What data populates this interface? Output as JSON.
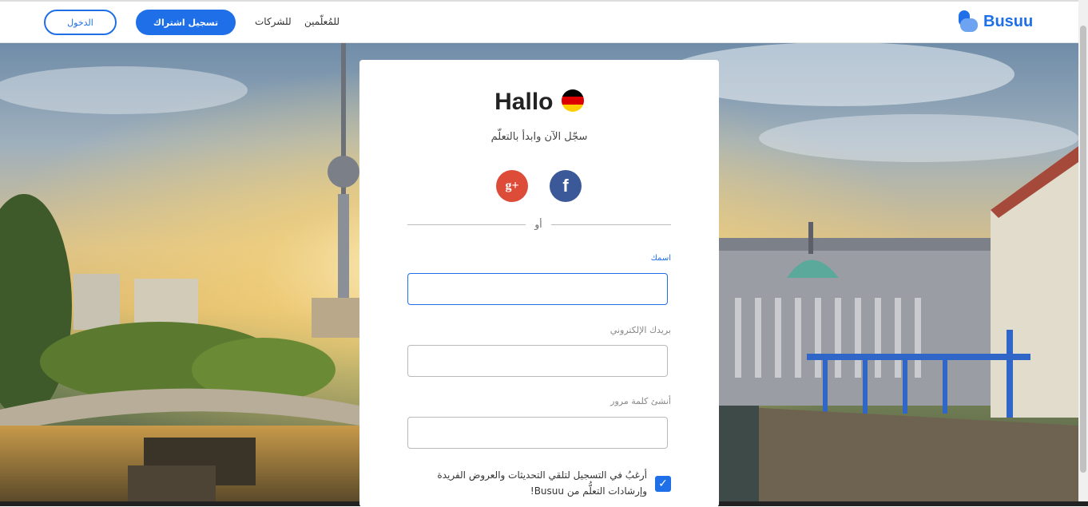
{
  "header": {
    "logo_text": "Busuu",
    "login_label": "الدخول",
    "signup_label": "تسجيل اشتراك",
    "companies_label": "للشركات",
    "teachers_label": "للمُعلّمين"
  },
  "card": {
    "greeting": "Hallo",
    "subtitle": "سجّل الآن وابدأ بالتعلّم",
    "google_icon_text": "g+",
    "facebook_icon_text": "f",
    "or_label": "أو",
    "name_label": "اسمك",
    "email_label": "بريدك الإلكتروني",
    "password_label": "أنشئ كلمة مرور",
    "name_value": "",
    "email_value": "",
    "password_value": "",
    "consent_text": "أرغبُ في التسجيل لتلقي التحديثات والعروض الفريدة وإرشادات التعلُّم من Busuu!",
    "consent_checked": true
  },
  "colors": {
    "brand": "#1f6fe8",
    "google": "#dd4b39",
    "facebook": "#3b5998"
  },
  "icons": {
    "flag": "germany-flag-icon",
    "check": "checkmark-icon"
  }
}
